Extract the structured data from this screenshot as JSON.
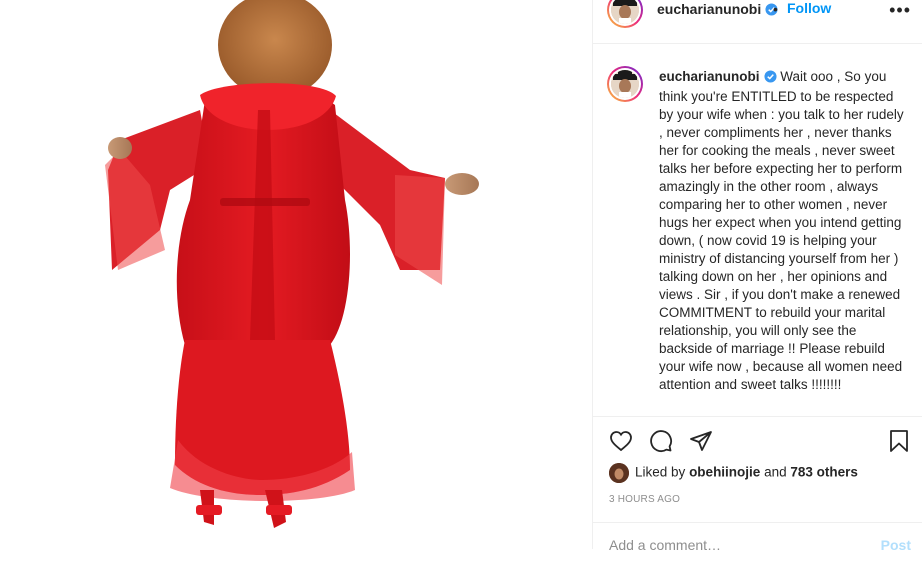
{
  "post": {
    "username": "eucharianunobi",
    "follow_label": "Follow",
    "separator": "•",
    "more_label": "•••",
    "caption_text": "Wait ooo , So you think you're ENTITLED to be respected by your wife when : you talk to her rudely , never compliments her , never thanks her for cooking the meals , never sweet talks her before expecting her to perform amazingly in the other room , always comparing her to other women , never hugs her expect when you intend getting down, ( now covid 19 is helping your ministry of distancing yourself from her ) talking down on her , her opinions and views . Sir , if you don't make a renewed COMMITMENT to rebuild your marital relationship, you will only see the backside of marriage !! Please rebuild your wife now , because all women need attention and sweet talks !!!!!!!!",
    "likes": {
      "prefix": "Liked by",
      "liker": "obehiinojie",
      "joiner": "and",
      "others": "783 others"
    },
    "timestamp": "3 HOURS AGO",
    "comment_placeholder": "Add a comment…",
    "post_label": "Post"
  },
  "icons": [
    "heart-icon",
    "comment-icon",
    "share-icon",
    "bookmark-icon",
    "verified-badge-icon"
  ],
  "colors": {
    "accent": "#0095f6",
    "post_disabled": "#b2dffc",
    "dress_red": "#e0141e",
    "hair": "#b4733f",
    "verified": "#3897f0"
  }
}
